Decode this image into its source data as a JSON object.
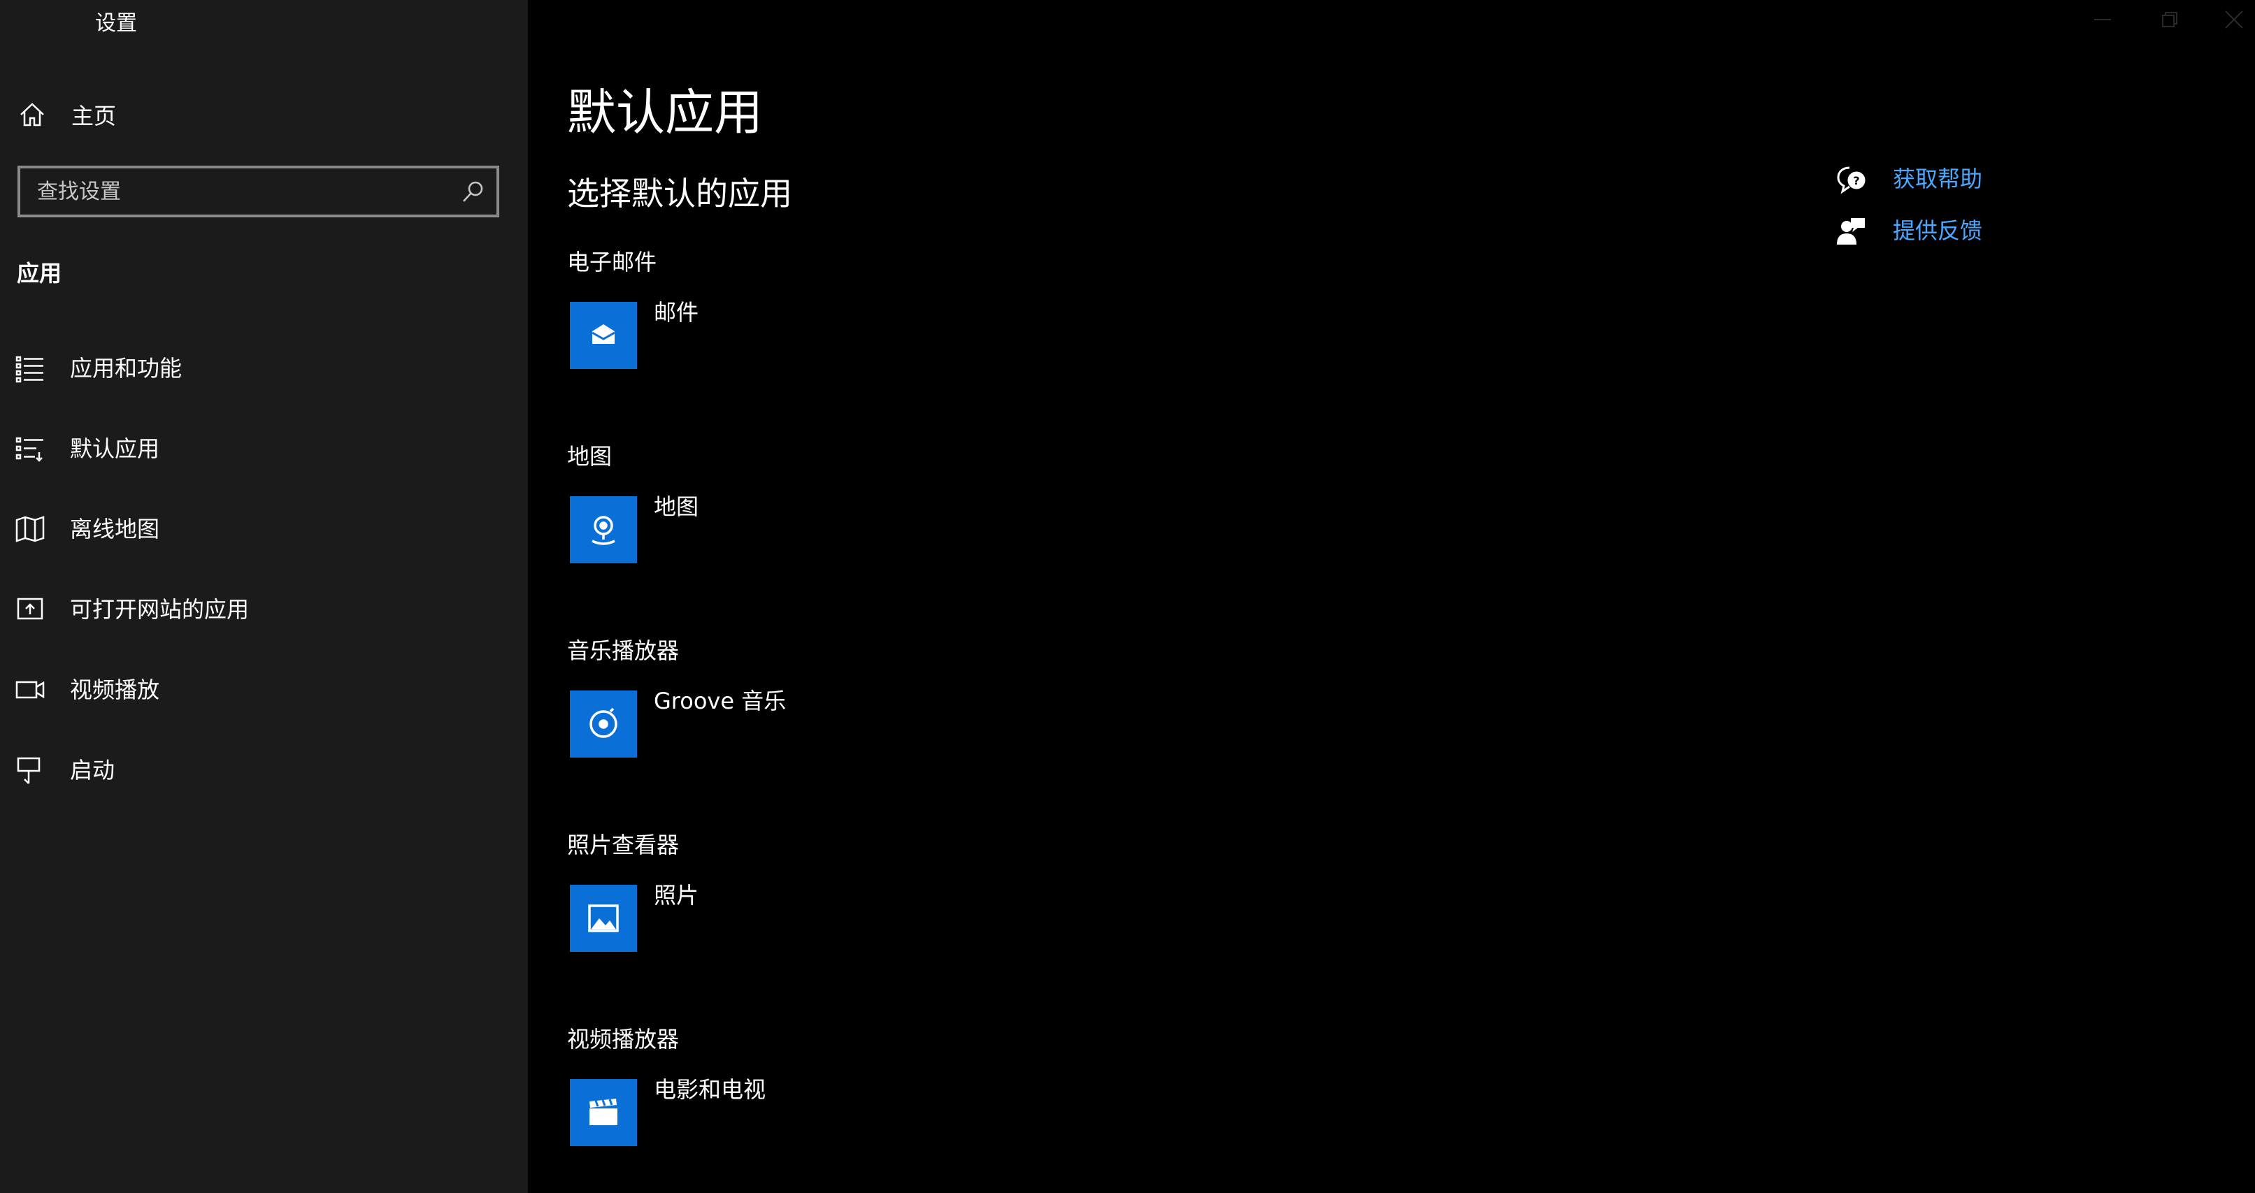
{
  "window": {
    "title": "设置"
  },
  "sidebar": {
    "home_label": "主页",
    "search_placeholder": "查找设置",
    "section_heading": "应用",
    "items": [
      {
        "label": "应用和功能",
        "icon": "apps-list-icon"
      },
      {
        "label": "默认应用",
        "icon": "default-apps-icon"
      },
      {
        "label": "离线地图",
        "icon": "offline-map-icon"
      },
      {
        "label": "可打开网站的应用",
        "icon": "apps-for-websites-icon"
      },
      {
        "label": "视频播放",
        "icon": "video-playback-icon"
      },
      {
        "label": "启动",
        "icon": "startup-icon"
      }
    ]
  },
  "main": {
    "title": "默认应用",
    "subtitle": "选择默认的应用",
    "categories": [
      {
        "label": "电子邮件",
        "app": "邮件",
        "icon": "mail-icon"
      },
      {
        "label": "地图",
        "app": "地图",
        "icon": "maps-icon"
      },
      {
        "label": "音乐播放器",
        "app": "Groove 音乐",
        "icon": "groove-music-icon"
      },
      {
        "label": "照片查看器",
        "app": "照片",
        "icon": "photos-icon"
      },
      {
        "label": "视频播放器",
        "app": "电影和电视",
        "icon": "movies-tv-icon"
      }
    ]
  },
  "help": {
    "get_help": "获取帮助",
    "give_feedback": "提供反馈"
  },
  "colors": {
    "sidebar_bg": "#1b1b1b",
    "main_bg": "#000000",
    "accent": "#0a6fd6",
    "link": "#4aa8ff"
  }
}
